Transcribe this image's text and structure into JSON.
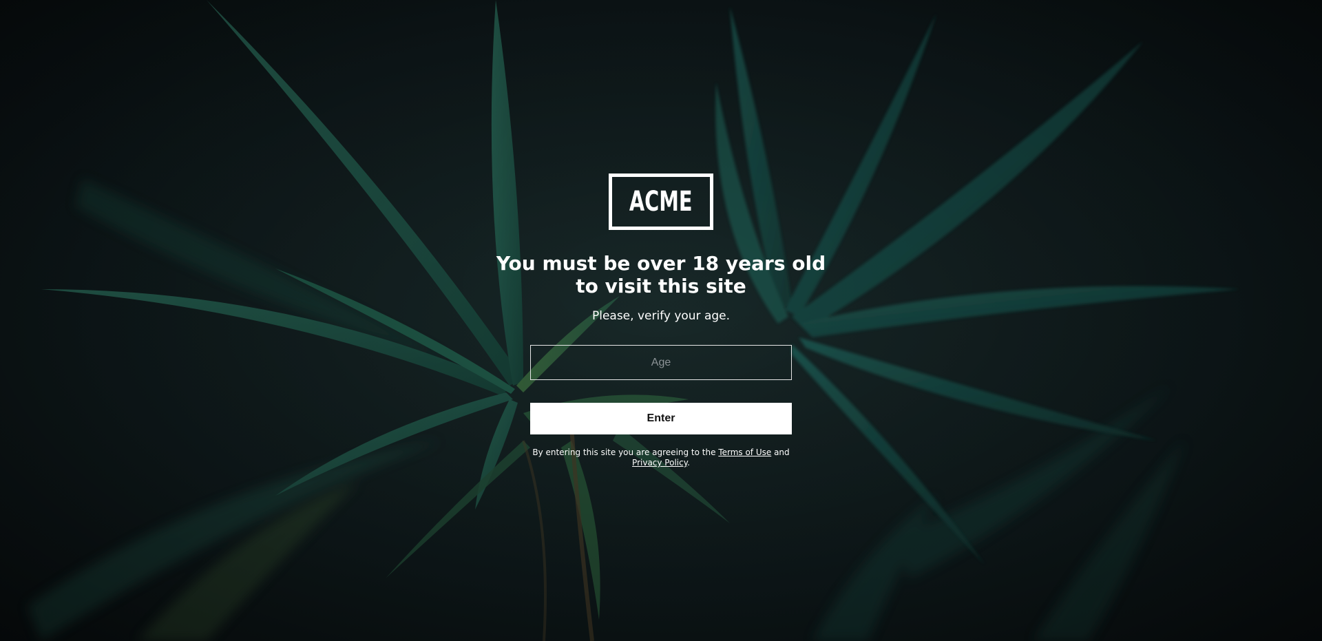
{
  "brand": {
    "logo_text": "ACME"
  },
  "age_gate": {
    "heading": "You must be over 18 years old to visit this site",
    "subheading": "Please, verify your age.",
    "age_input_placeholder": "Age",
    "age_input_value": "",
    "enter_label": "Enter"
  },
  "legal": {
    "prefix": "By entering this site you are agreeing to the ",
    "terms_label": "Terms of Use",
    "connector": " and ",
    "privacy_label": "Privacy Policy",
    "suffix": "."
  },
  "background": {
    "image": "cannabis-leaf-photo",
    "leaf_color": "#1f5a4e",
    "leaf_dark": "#123b35",
    "backdrop": "#0c1416"
  }
}
